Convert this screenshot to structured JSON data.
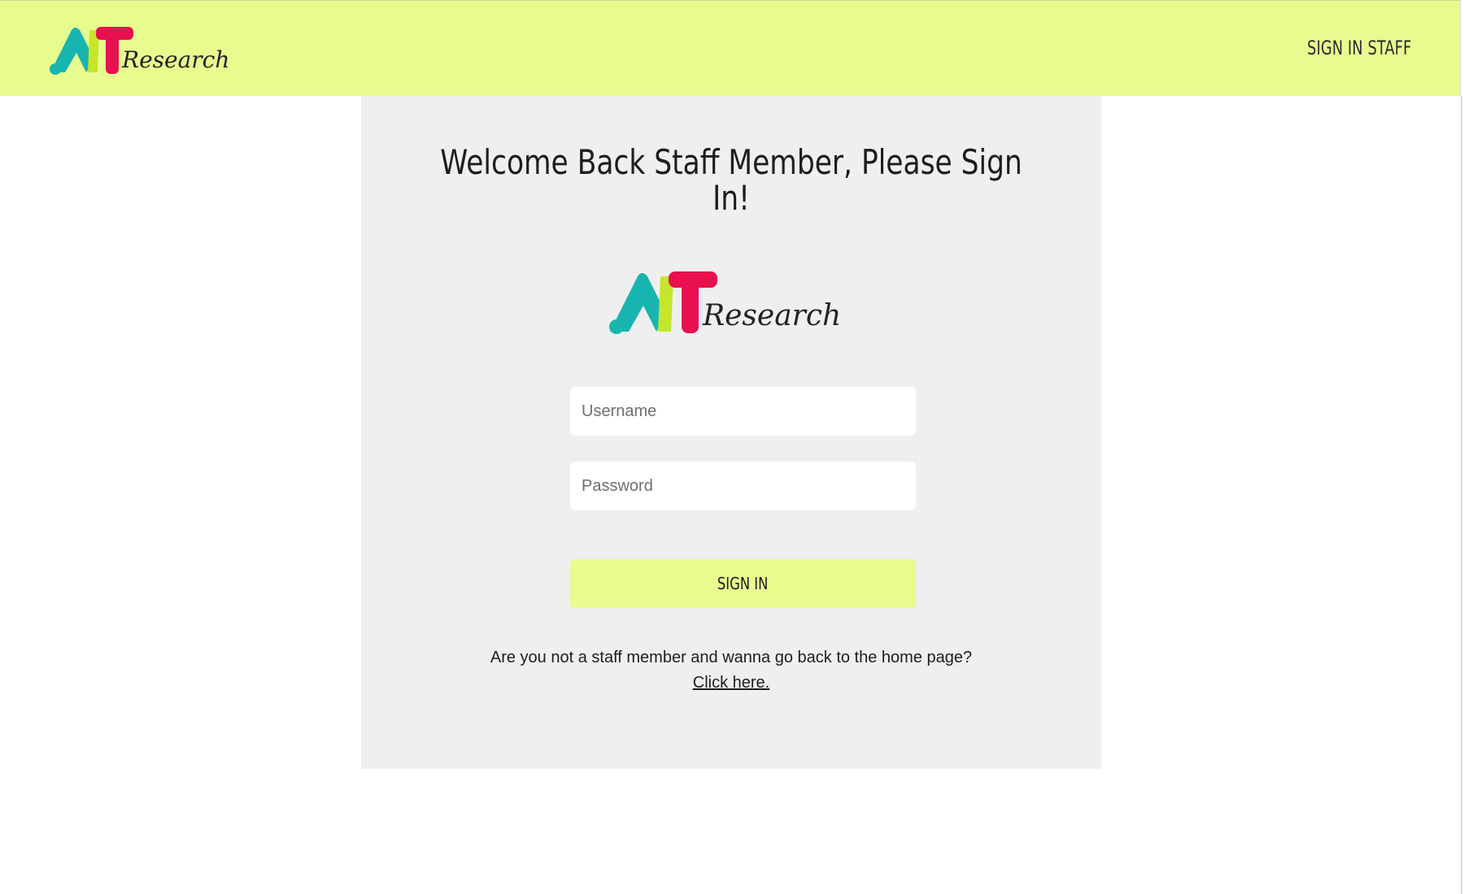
{
  "header": {
    "logo_alt": "AIT Research",
    "nav_signin_staff": "SIGN IN STAFF"
  },
  "card": {
    "title": "Welcome Back Staff Member, Please Sign In!",
    "logo_alt": "AIT Research",
    "username_placeholder": "Username",
    "username_value": "",
    "password_placeholder": "Password",
    "password_value": "",
    "signin_label": "SIGN IN",
    "helper_text": "Are you not a staff member and wanna go back to the home page? ",
    "helper_link": "Click here."
  },
  "colors": {
    "brand_lime": "#e8fb8f",
    "card_bg": "#efefef",
    "logo_teal": "#18b5b0",
    "logo_magenta": "#e8104f",
    "logo_lime": "#c7e52a"
  },
  "logo": {
    "wordmark": "Research"
  }
}
